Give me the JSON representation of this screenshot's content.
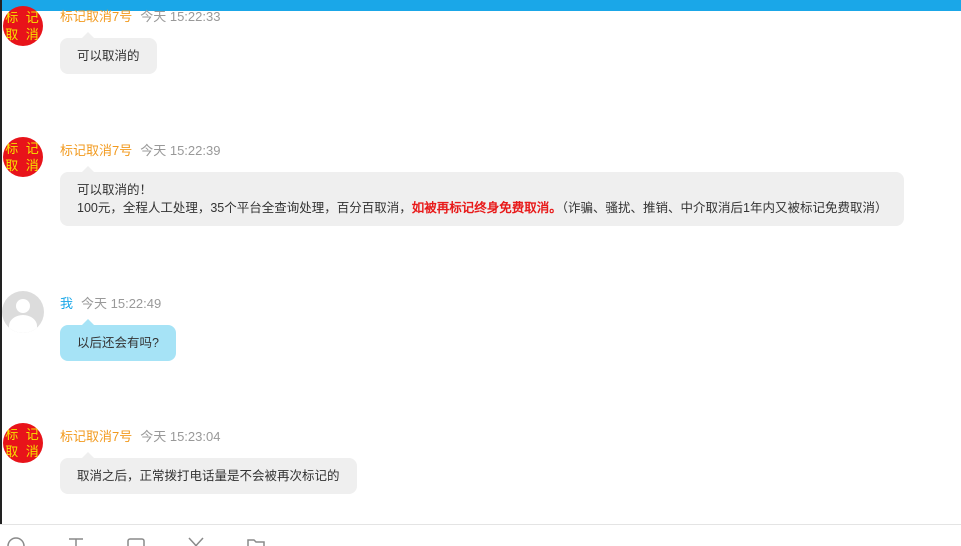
{
  "messages": [
    {
      "sender": "标记取消7号",
      "time": "今天 15:22:33",
      "avatar_line1": "标 记",
      "avatar_line2": "取 消",
      "text": "可以取消的"
    },
    {
      "sender": "标记取消7号",
      "time": "今天 15:22:39",
      "avatar_line1": "标 记",
      "avatar_line2": "取 消",
      "line1": "可以取消的！",
      "line2_prefix": "100元，全程人工处理，35个平台全查询处理，百分百取消，",
      "line2_highlight": "如被再标记终身免费取消。",
      "line2_suffix": "（诈骗、骚扰、推销、中介取消后1年内又被标记免费取消）"
    },
    {
      "sender": "我",
      "time": "今天 15:22:49",
      "text": "以后还会有吗?"
    },
    {
      "sender": "标记取消7号",
      "time": "今天 15:23:04",
      "avatar_line1": "标 记",
      "avatar_line2": "取 消",
      "text": "取消之后，正常拨打电话量是不会被再次标记的"
    }
  ],
  "toolbar": {
    "icons": [
      "emoji-icon",
      "text-format-icon",
      "image-icon",
      "scissors-icon",
      "folder-icon"
    ]
  },
  "colors": {
    "topbar": "#1aa7e8",
    "other_name": "#f29a1e",
    "me_name": "#1aa7e8",
    "avatar_badge": "#e8131a",
    "highlight": "#e81a1a",
    "me_bubble": "#a6e3f6",
    "other_bubble": "#efefef"
  }
}
